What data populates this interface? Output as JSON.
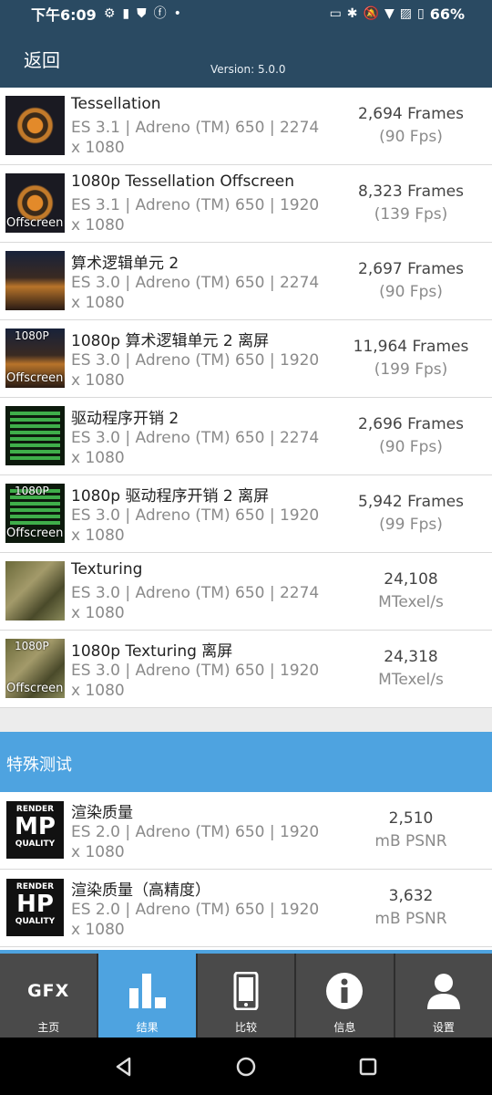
{
  "status": {
    "time": "下午6:09",
    "battery": "66%"
  },
  "header": {
    "back": "返回",
    "version": "Version: 5.0.0"
  },
  "tests": [
    {
      "title": "Tessellation",
      "sub": "ES 3.1 | Adreno (TM) 650 | 2274 x 1080",
      "value": "2,694 Frames",
      "unit": "(90 Fps)",
      "icon": "tessellation-thumbnail"
    },
    {
      "title": "1080p Tessellation Offscreen",
      "sub": "ES 3.1 | Adreno (TM) 650 | 1920 x 1080",
      "value": "8,323 Frames",
      "unit": "(139 Fps)",
      "icon": "tessellation-offscreen-thumbnail",
      "bottom_tag": "Offscreen"
    },
    {
      "title": "算术逻辑单元 2",
      "sub": "ES 3.0 | Adreno (TM) 650 | 2274 x 1080",
      "value": "2,697 Frames",
      "unit": "(90 Fps)",
      "icon": "alu-thumbnail"
    },
    {
      "title": "1080p 算术逻辑单元 2 离屏",
      "sub": "ES 3.0 | Adreno (TM) 650 | 1920 x 1080",
      "value": "11,964 Frames",
      "unit": "(199 Fps)",
      "icon": "alu-offscreen-thumbnail",
      "top_tag": "1080P",
      "bottom_tag": "Offscreen"
    },
    {
      "title": "驱动程序开销 2",
      "sub": "ES 3.0 | Adreno (TM) 650 | 2274 x 1080",
      "value": "2,696 Frames",
      "unit": "(90 Fps)",
      "icon": "driver-overhead-thumbnail"
    },
    {
      "title": "1080p 驱动程序开销 2 离屏",
      "sub": "ES 3.0 | Adreno (TM) 650 | 1920 x 1080",
      "value": "5,942 Frames",
      "unit": "(99 Fps)",
      "icon": "driver-overhead-offscreen-thumbnail",
      "top_tag": "1080P",
      "bottom_tag": "Offscreen"
    },
    {
      "title": "Texturing",
      "sub": "ES 3.0 | Adreno (TM) 650 | 2274 x 1080",
      "value": "24,108",
      "unit": "MTexel/s",
      "icon": "texturing-thumbnail"
    },
    {
      "title": "1080p Texturing 离屏",
      "sub": "ES 3.0 | Adreno (TM) 650 | 1920 x 1080",
      "value": "24,318",
      "unit": "MTexel/s",
      "icon": "texturing-offscreen-thumbnail",
      "top_tag": "1080P",
      "bottom_tag": "Offscreen"
    }
  ],
  "special_section": "特殊测试",
  "special_tests": [
    {
      "title": "渲染质量",
      "sub": "ES 2.0 | Adreno (TM) 650 | 1920 x 1080",
      "value": "2,510",
      "unit": "mB PSNR",
      "badge_top": "RENDER",
      "badge_big": "MP",
      "badge_bottom": "QUALITY"
    },
    {
      "title": "渲染质量（高精度）",
      "sub": "ES 2.0 | Adreno (TM) 650 | 1920 x 1080",
      "value": "3,632",
      "unit": "mB PSNR",
      "badge_top": "RENDER",
      "badge_big": "HP",
      "badge_bottom": "QUALITY"
    }
  ],
  "tabs": [
    {
      "label": "主页",
      "logo": "GFX",
      "active": false
    },
    {
      "label": "结果",
      "active": true
    },
    {
      "label": "比较",
      "active": false
    },
    {
      "label": "信息",
      "active": false
    },
    {
      "label": "设置",
      "active": false
    }
  ],
  "colors": {
    "header": "#2a4a62",
    "accent": "#4ea3e0"
  }
}
